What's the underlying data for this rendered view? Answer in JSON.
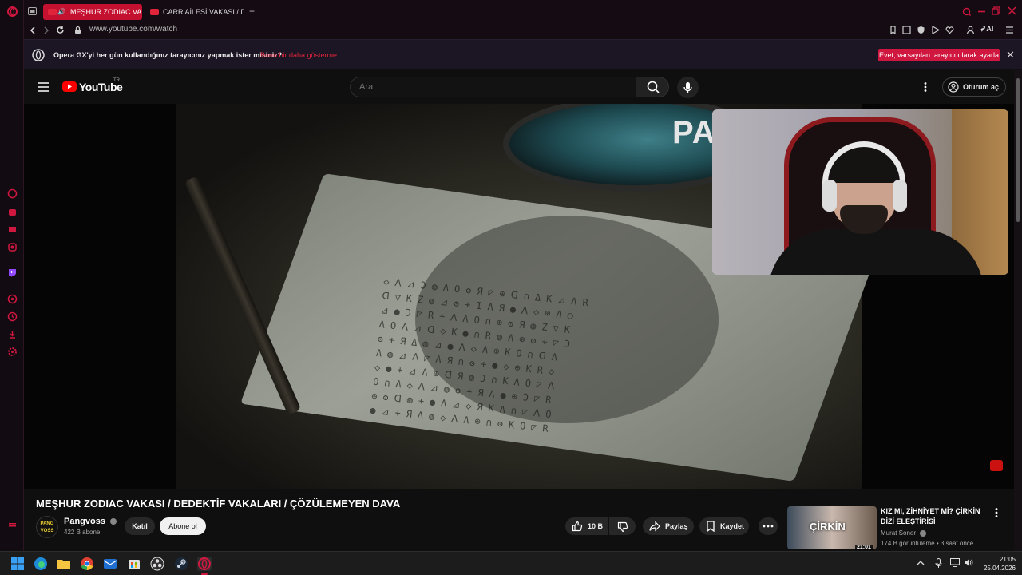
{
  "browser": {
    "tabs": [
      {
        "label": "MEŞHUR ZODIAC VAKA",
        "active": true
      },
      {
        "label": "CARR AİLESİ VAKASI / DE",
        "active": false
      }
    ],
    "new_tab_label": "+",
    "url": "www.youtube.com/watch",
    "accent": "#d0173f",
    "window_controls": [
      "minimize-icon",
      "maximize-icon",
      "close-icon"
    ],
    "toolbar_icons": [
      "snapshot-icon",
      "easy-setup-icon",
      "shield-icon",
      "play-icon",
      "heart-icon",
      "profile-icon",
      "aria-ai-icon",
      "menu-icon"
    ],
    "ai_label": "AI"
  },
  "banner": {
    "text": "Opera GX'yi her gün kullandığınız tarayıcınız yapmak ister misiniz?",
    "link": "Bunu bir daha gösterme",
    "button": "Evet, varsayılan tarayıcı olarak ayarla",
    "close": "✕"
  },
  "youtube": {
    "logo_text": "YouTube",
    "region": "TR",
    "search_placeholder": "Ara",
    "signin_label": "Oturum aç"
  },
  "player": {
    "overlay_text": "PA"
  },
  "video": {
    "title": "MEŞHUR ZODIAC VAKASI / DEDEKTİF VAKALARI / ÇÖZÜLEMEYEN DAVA",
    "channel": "Pangvoss",
    "channel_avatar_text": "PANG VOSS",
    "subscribers": "422 B abone",
    "join_label": "Katıl",
    "subscribe_label": "Abone ol",
    "likes": "10 B",
    "share_label": "Paylaş",
    "save_label": "Kaydet"
  },
  "recommended": {
    "title": "KIZ MI, ZİHNİYET Mİ? ÇİRKİN DİZİ ELEŞTİRİSİ",
    "channel": "Murat Soner",
    "meta": "174 B görüntüleme • 3 saat önce",
    "duration": "21:01",
    "thumb_text": "ÇİRKİN"
  },
  "taskbar": {
    "apps": [
      "windows-start",
      "edge",
      "file-explorer",
      "chrome",
      "outlook",
      "store",
      "obs",
      "steam",
      "opera-gx"
    ],
    "time": "21:05",
    "date": "25.04.2026"
  }
}
